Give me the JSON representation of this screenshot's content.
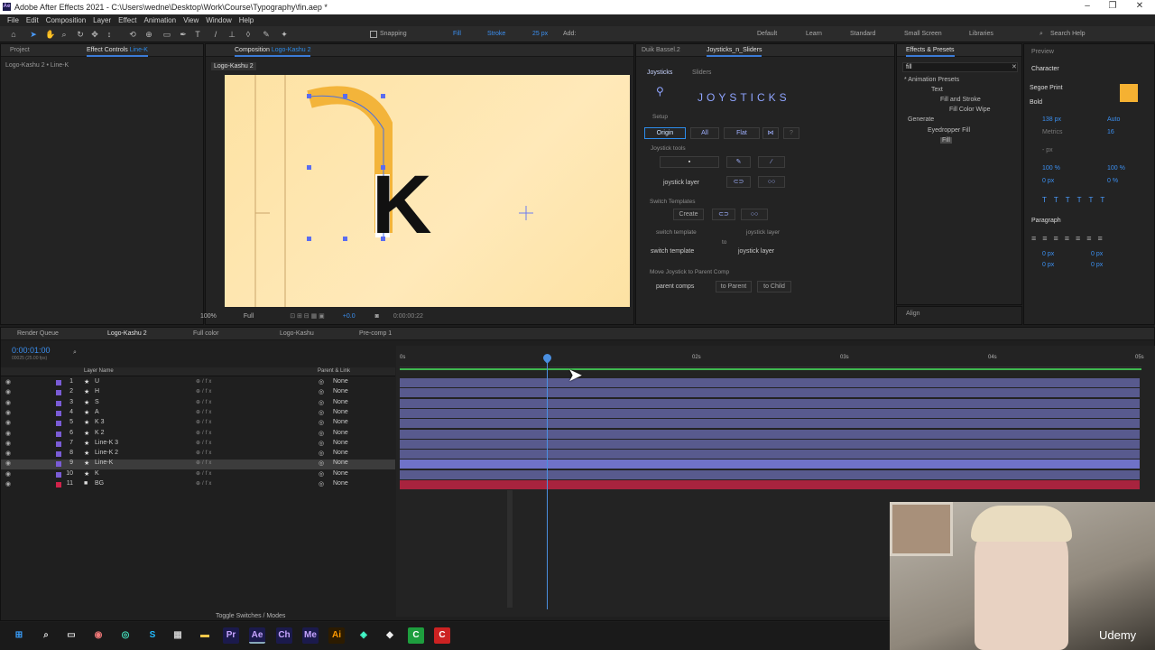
{
  "window": {
    "title": "Adobe After Effects 2021 - C:\\Users\\wedne\\Desktop\\Work\\Course\\Typography\\fin.aep *",
    "logo": "Ae"
  },
  "menu": [
    "File",
    "Edit",
    "Composition",
    "Layer",
    "Effect",
    "Animation",
    "View",
    "Window",
    "Help"
  ],
  "toolbar": {
    "snapping": "Snapping",
    "fill": "Fill",
    "stroke": "Stroke",
    "stroke_px": "25 px",
    "add": "Add:",
    "workspaces": [
      "Default",
      "Learn",
      "Standard",
      "Small Screen",
      "Libraries"
    ],
    "search_placeholder": "Search Help"
  },
  "project_panel": {
    "tab_project": "Project",
    "tab_effect_controls": "Effect Controls",
    "effect_controls_target": "Line-K",
    "breadcrumb": "Logo-Kashu 2 • Line-K"
  },
  "composition_panel": {
    "tab": "Composition",
    "comp_name": "Logo-Kashu 2",
    "subtab": "Logo-Kashu 2",
    "glyph": "K",
    "zoom": "100%",
    "resolution": "Full",
    "plus": "+0.0",
    "timecode": "0:00:00:22"
  },
  "joysticks_panel": {
    "tabs": [
      "Duik Bassel.2",
      "Joysticks_n_Sliders"
    ],
    "subtabs": [
      "Joysticks",
      "Sliders"
    ],
    "brand": "JOYSTICKS",
    "setup": "Setup",
    "origin": "Origin",
    "all": "All",
    "flat": "Flat",
    "joystick_tools": "Joystick tools",
    "joystick_layer": "joystick layer",
    "switch_templates": "Switch Templates",
    "create": "Create",
    "switch_template_lbl": "switch template",
    "joystick_layer_lbl": "joystick layer",
    "to": "to",
    "switch_template_dd": "switch template",
    "joystick_layer_dd": "joystick layer",
    "move_parent": "Move Joystick to Parent Comp",
    "parent_comps": "parent comps",
    "to_parent": "to Parent",
    "to_child": "to Child"
  },
  "effects_presets": {
    "tab": "Effects & Presets",
    "search": "fill",
    "tree": [
      "* Animation Presets",
      "Text",
      "Fill and Stroke",
      "Fill Color Wipe",
      "Generate",
      "Eyedropper Fill",
      "Fill"
    ]
  },
  "character_panel": {
    "preview": "Preview",
    "title": "Character",
    "font": "Segoe Print",
    "style": "Bold",
    "size": "138 px",
    "leading": "Auto",
    "kerning": "Metrics",
    "tracking": "16",
    "unit": "- px",
    "vscale": "100 %",
    "hscale": "100 %",
    "baseline": "0 px",
    "tsume": "0 %",
    "paragraph": "Paragraph",
    "p_left": "0 px",
    "p_right": "0 px",
    "p_first": "0 px",
    "p_before": "0 px",
    "p_after": "0 px",
    "align": "Align",
    "fill_color": "#f5b132"
  },
  "timeline": {
    "tabs": [
      "Render Queue",
      "Logo-Kashu 2",
      "Full color",
      "Logo-Kashu",
      "Pre-comp 1"
    ],
    "current_time": "0:00:01:00",
    "fps": "00025 (25.00 fps)",
    "col_layer": "Layer Name",
    "col_parent": "Parent & Link",
    "ruler": [
      "0s",
      "02s",
      "03s",
      "04s",
      "05s"
    ],
    "footer": "Toggle Switches / Modes",
    "layers": [
      {
        "num": "1",
        "name": "U",
        "parent": "None",
        "color": "#7a5cd6"
      },
      {
        "num": "2",
        "name": "H",
        "parent": "None",
        "color": "#7a5cd6"
      },
      {
        "num": "3",
        "name": "S",
        "parent": "None",
        "color": "#7a5cd6"
      },
      {
        "num": "4",
        "name": "A",
        "parent": "None",
        "color": "#7a5cd6"
      },
      {
        "num": "5",
        "name": "K 3",
        "parent": "None",
        "color": "#7a5cd6"
      },
      {
        "num": "6",
        "name": "K 2",
        "parent": "None",
        "color": "#7a5cd6"
      },
      {
        "num": "7",
        "name": "Line-K 3",
        "parent": "None",
        "color": "#7a5cd6"
      },
      {
        "num": "8",
        "name": "Line-K 2",
        "parent": "None",
        "color": "#7a5cd6"
      },
      {
        "num": "9",
        "name": "Line-K",
        "parent": "None",
        "color": "#7a5cd6"
      },
      {
        "num": "10",
        "name": "K",
        "parent": "None",
        "color": "#7a5cd6"
      },
      {
        "num": "11",
        "name": "BG",
        "parent": "None",
        "color": "#d0234a"
      }
    ]
  },
  "watermark": "Udemy"
}
